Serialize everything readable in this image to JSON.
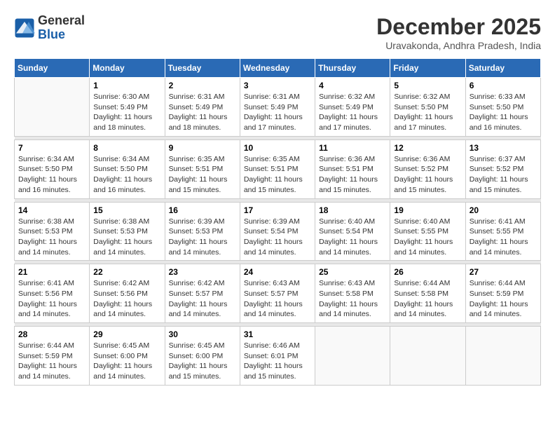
{
  "logo": {
    "line1": "General",
    "line2": "Blue"
  },
  "title": "December 2025",
  "subtitle": "Uravakonda, Andhra Pradesh, India",
  "days_header": [
    "Sunday",
    "Monday",
    "Tuesday",
    "Wednesday",
    "Thursday",
    "Friday",
    "Saturday"
  ],
  "weeks": [
    [
      {
        "day": "",
        "info": ""
      },
      {
        "day": "1",
        "info": "Sunrise: 6:30 AM\nSunset: 5:49 PM\nDaylight: 11 hours\nand 18 minutes."
      },
      {
        "day": "2",
        "info": "Sunrise: 6:31 AM\nSunset: 5:49 PM\nDaylight: 11 hours\nand 18 minutes."
      },
      {
        "day": "3",
        "info": "Sunrise: 6:31 AM\nSunset: 5:49 PM\nDaylight: 11 hours\nand 17 minutes."
      },
      {
        "day": "4",
        "info": "Sunrise: 6:32 AM\nSunset: 5:49 PM\nDaylight: 11 hours\nand 17 minutes."
      },
      {
        "day": "5",
        "info": "Sunrise: 6:32 AM\nSunset: 5:50 PM\nDaylight: 11 hours\nand 17 minutes."
      },
      {
        "day": "6",
        "info": "Sunrise: 6:33 AM\nSunset: 5:50 PM\nDaylight: 11 hours\nand 16 minutes."
      }
    ],
    [
      {
        "day": "7",
        "info": "Sunrise: 6:34 AM\nSunset: 5:50 PM\nDaylight: 11 hours\nand 16 minutes."
      },
      {
        "day": "8",
        "info": "Sunrise: 6:34 AM\nSunset: 5:50 PM\nDaylight: 11 hours\nand 16 minutes."
      },
      {
        "day": "9",
        "info": "Sunrise: 6:35 AM\nSunset: 5:51 PM\nDaylight: 11 hours\nand 15 minutes."
      },
      {
        "day": "10",
        "info": "Sunrise: 6:35 AM\nSunset: 5:51 PM\nDaylight: 11 hours\nand 15 minutes."
      },
      {
        "day": "11",
        "info": "Sunrise: 6:36 AM\nSunset: 5:51 PM\nDaylight: 11 hours\nand 15 minutes."
      },
      {
        "day": "12",
        "info": "Sunrise: 6:36 AM\nSunset: 5:52 PM\nDaylight: 11 hours\nand 15 minutes."
      },
      {
        "day": "13",
        "info": "Sunrise: 6:37 AM\nSunset: 5:52 PM\nDaylight: 11 hours\nand 15 minutes."
      }
    ],
    [
      {
        "day": "14",
        "info": "Sunrise: 6:38 AM\nSunset: 5:53 PM\nDaylight: 11 hours\nand 14 minutes."
      },
      {
        "day": "15",
        "info": "Sunrise: 6:38 AM\nSunset: 5:53 PM\nDaylight: 11 hours\nand 14 minutes."
      },
      {
        "day": "16",
        "info": "Sunrise: 6:39 AM\nSunset: 5:53 PM\nDaylight: 11 hours\nand 14 minutes."
      },
      {
        "day": "17",
        "info": "Sunrise: 6:39 AM\nSunset: 5:54 PM\nDaylight: 11 hours\nand 14 minutes."
      },
      {
        "day": "18",
        "info": "Sunrise: 6:40 AM\nSunset: 5:54 PM\nDaylight: 11 hours\nand 14 minutes."
      },
      {
        "day": "19",
        "info": "Sunrise: 6:40 AM\nSunset: 5:55 PM\nDaylight: 11 hours\nand 14 minutes."
      },
      {
        "day": "20",
        "info": "Sunrise: 6:41 AM\nSunset: 5:55 PM\nDaylight: 11 hours\nand 14 minutes."
      }
    ],
    [
      {
        "day": "21",
        "info": "Sunrise: 6:41 AM\nSunset: 5:56 PM\nDaylight: 11 hours\nand 14 minutes."
      },
      {
        "day": "22",
        "info": "Sunrise: 6:42 AM\nSunset: 5:56 PM\nDaylight: 11 hours\nand 14 minutes."
      },
      {
        "day": "23",
        "info": "Sunrise: 6:42 AM\nSunset: 5:57 PM\nDaylight: 11 hours\nand 14 minutes."
      },
      {
        "day": "24",
        "info": "Sunrise: 6:43 AM\nSunset: 5:57 PM\nDaylight: 11 hours\nand 14 minutes."
      },
      {
        "day": "25",
        "info": "Sunrise: 6:43 AM\nSunset: 5:58 PM\nDaylight: 11 hours\nand 14 minutes."
      },
      {
        "day": "26",
        "info": "Sunrise: 6:44 AM\nSunset: 5:58 PM\nDaylight: 11 hours\nand 14 minutes."
      },
      {
        "day": "27",
        "info": "Sunrise: 6:44 AM\nSunset: 5:59 PM\nDaylight: 11 hours\nand 14 minutes."
      }
    ],
    [
      {
        "day": "28",
        "info": "Sunrise: 6:44 AM\nSunset: 5:59 PM\nDaylight: 11 hours\nand 14 minutes."
      },
      {
        "day": "29",
        "info": "Sunrise: 6:45 AM\nSunset: 6:00 PM\nDaylight: 11 hours\nand 14 minutes."
      },
      {
        "day": "30",
        "info": "Sunrise: 6:45 AM\nSunset: 6:00 PM\nDaylight: 11 hours\nand 15 minutes."
      },
      {
        "day": "31",
        "info": "Sunrise: 6:46 AM\nSunset: 6:01 PM\nDaylight: 11 hours\nand 15 minutes."
      },
      {
        "day": "",
        "info": ""
      },
      {
        "day": "",
        "info": ""
      },
      {
        "day": "",
        "info": ""
      }
    ]
  ]
}
